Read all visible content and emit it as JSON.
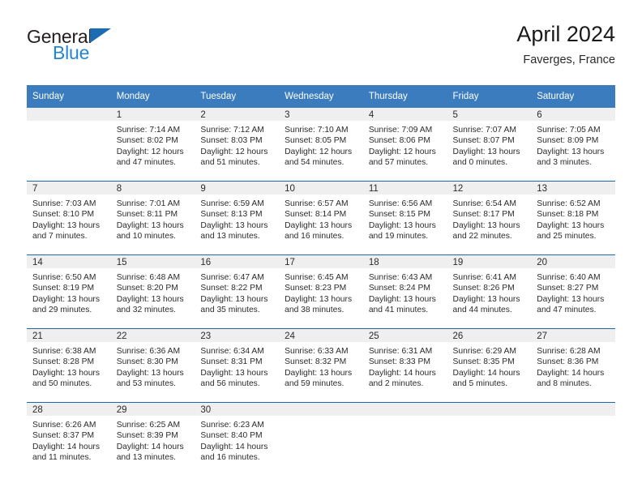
{
  "brand": {
    "name_top": "General",
    "name_bottom": "Blue",
    "triangle_color": "#1b6cb3",
    "blue_color": "#2585d3"
  },
  "header": {
    "title": "April 2024",
    "subtitle": "Faverges, France"
  },
  "theme": {
    "header_blue": "#3a7cbd",
    "separator_blue": "#1b68ad",
    "daynum_band": "#efefef"
  },
  "weekday_headers": [
    "Sunday",
    "Monday",
    "Tuesday",
    "Wednesday",
    "Thursday",
    "Friday",
    "Saturday"
  ],
  "labels": {
    "sunrise": "Sunrise:",
    "sunset": "Sunset:",
    "daylight": "Daylight:"
  },
  "weeks": [
    [
      {
        "day": "",
        "empty": true
      },
      {
        "day": "1",
        "sunrise": "Sunrise: 7:14 AM",
        "sunset": "Sunset: 8:02 PM",
        "daylight_line1": "Daylight: 12 hours",
        "daylight_line2": "and 47 minutes."
      },
      {
        "day": "2",
        "sunrise": "Sunrise: 7:12 AM",
        "sunset": "Sunset: 8:03 PM",
        "daylight_line1": "Daylight: 12 hours",
        "daylight_line2": "and 51 minutes."
      },
      {
        "day": "3",
        "sunrise": "Sunrise: 7:10 AM",
        "sunset": "Sunset: 8:05 PM",
        "daylight_line1": "Daylight: 12 hours",
        "daylight_line2": "and 54 minutes."
      },
      {
        "day": "4",
        "sunrise": "Sunrise: 7:09 AM",
        "sunset": "Sunset: 8:06 PM",
        "daylight_line1": "Daylight: 12 hours",
        "daylight_line2": "and 57 minutes."
      },
      {
        "day": "5",
        "sunrise": "Sunrise: 7:07 AM",
        "sunset": "Sunset: 8:07 PM",
        "daylight_line1": "Daylight: 13 hours",
        "daylight_line2": "and 0 minutes."
      },
      {
        "day": "6",
        "sunrise": "Sunrise: 7:05 AM",
        "sunset": "Sunset: 8:09 PM",
        "daylight_line1": "Daylight: 13 hours",
        "daylight_line2": "and 3 minutes."
      }
    ],
    [
      {
        "day": "7",
        "sunrise": "Sunrise: 7:03 AM",
        "sunset": "Sunset: 8:10 PM",
        "daylight_line1": "Daylight: 13 hours",
        "daylight_line2": "and 7 minutes."
      },
      {
        "day": "8",
        "sunrise": "Sunrise: 7:01 AM",
        "sunset": "Sunset: 8:11 PM",
        "daylight_line1": "Daylight: 13 hours",
        "daylight_line2": "and 10 minutes."
      },
      {
        "day": "9",
        "sunrise": "Sunrise: 6:59 AM",
        "sunset": "Sunset: 8:13 PM",
        "daylight_line1": "Daylight: 13 hours",
        "daylight_line2": "and 13 minutes."
      },
      {
        "day": "10",
        "sunrise": "Sunrise: 6:57 AM",
        "sunset": "Sunset: 8:14 PM",
        "daylight_line1": "Daylight: 13 hours",
        "daylight_line2": "and 16 minutes."
      },
      {
        "day": "11",
        "sunrise": "Sunrise: 6:56 AM",
        "sunset": "Sunset: 8:15 PM",
        "daylight_line1": "Daylight: 13 hours",
        "daylight_line2": "and 19 minutes."
      },
      {
        "day": "12",
        "sunrise": "Sunrise: 6:54 AM",
        "sunset": "Sunset: 8:17 PM",
        "daylight_line1": "Daylight: 13 hours",
        "daylight_line2": "and 22 minutes."
      },
      {
        "day": "13",
        "sunrise": "Sunrise: 6:52 AM",
        "sunset": "Sunset: 8:18 PM",
        "daylight_line1": "Daylight: 13 hours",
        "daylight_line2": "and 25 minutes."
      }
    ],
    [
      {
        "day": "14",
        "sunrise": "Sunrise: 6:50 AM",
        "sunset": "Sunset: 8:19 PM",
        "daylight_line1": "Daylight: 13 hours",
        "daylight_line2": "and 29 minutes."
      },
      {
        "day": "15",
        "sunrise": "Sunrise: 6:48 AM",
        "sunset": "Sunset: 8:20 PM",
        "daylight_line1": "Daylight: 13 hours",
        "daylight_line2": "and 32 minutes."
      },
      {
        "day": "16",
        "sunrise": "Sunrise: 6:47 AM",
        "sunset": "Sunset: 8:22 PM",
        "daylight_line1": "Daylight: 13 hours",
        "daylight_line2": "and 35 minutes."
      },
      {
        "day": "17",
        "sunrise": "Sunrise: 6:45 AM",
        "sunset": "Sunset: 8:23 PM",
        "daylight_line1": "Daylight: 13 hours",
        "daylight_line2": "and 38 minutes."
      },
      {
        "day": "18",
        "sunrise": "Sunrise: 6:43 AM",
        "sunset": "Sunset: 8:24 PM",
        "daylight_line1": "Daylight: 13 hours",
        "daylight_line2": "and 41 minutes."
      },
      {
        "day": "19",
        "sunrise": "Sunrise: 6:41 AM",
        "sunset": "Sunset: 8:26 PM",
        "daylight_line1": "Daylight: 13 hours",
        "daylight_line2": "and 44 minutes."
      },
      {
        "day": "20",
        "sunrise": "Sunrise: 6:40 AM",
        "sunset": "Sunset: 8:27 PM",
        "daylight_line1": "Daylight: 13 hours",
        "daylight_line2": "and 47 minutes."
      }
    ],
    [
      {
        "day": "21",
        "sunrise": "Sunrise: 6:38 AM",
        "sunset": "Sunset: 8:28 PM",
        "daylight_line1": "Daylight: 13 hours",
        "daylight_line2": "and 50 minutes."
      },
      {
        "day": "22",
        "sunrise": "Sunrise: 6:36 AM",
        "sunset": "Sunset: 8:30 PM",
        "daylight_line1": "Daylight: 13 hours",
        "daylight_line2": "and 53 minutes."
      },
      {
        "day": "23",
        "sunrise": "Sunrise: 6:34 AM",
        "sunset": "Sunset: 8:31 PM",
        "daylight_line1": "Daylight: 13 hours",
        "daylight_line2": "and 56 minutes."
      },
      {
        "day": "24",
        "sunrise": "Sunrise: 6:33 AM",
        "sunset": "Sunset: 8:32 PM",
        "daylight_line1": "Daylight: 13 hours",
        "daylight_line2": "and 59 minutes."
      },
      {
        "day": "25",
        "sunrise": "Sunrise: 6:31 AM",
        "sunset": "Sunset: 8:33 PM",
        "daylight_line1": "Daylight: 14 hours",
        "daylight_line2": "and 2 minutes."
      },
      {
        "day": "26",
        "sunrise": "Sunrise: 6:29 AM",
        "sunset": "Sunset: 8:35 PM",
        "daylight_line1": "Daylight: 14 hours",
        "daylight_line2": "and 5 minutes."
      },
      {
        "day": "27",
        "sunrise": "Sunrise: 6:28 AM",
        "sunset": "Sunset: 8:36 PM",
        "daylight_line1": "Daylight: 14 hours",
        "daylight_line2": "and 8 minutes."
      }
    ],
    [
      {
        "day": "28",
        "sunrise": "Sunrise: 6:26 AM",
        "sunset": "Sunset: 8:37 PM",
        "daylight_line1": "Daylight: 14 hours",
        "daylight_line2": "and 11 minutes."
      },
      {
        "day": "29",
        "sunrise": "Sunrise: 6:25 AM",
        "sunset": "Sunset: 8:39 PM",
        "daylight_line1": "Daylight: 14 hours",
        "daylight_line2": "and 13 minutes."
      },
      {
        "day": "30",
        "sunrise": "Sunrise: 6:23 AM",
        "sunset": "Sunset: 8:40 PM",
        "daylight_line1": "Daylight: 14 hours",
        "daylight_line2": "and 16 minutes."
      },
      {
        "day": "",
        "empty": true
      },
      {
        "day": "",
        "empty": true
      },
      {
        "day": "",
        "empty": true
      },
      {
        "day": "",
        "empty": true
      }
    ]
  ]
}
